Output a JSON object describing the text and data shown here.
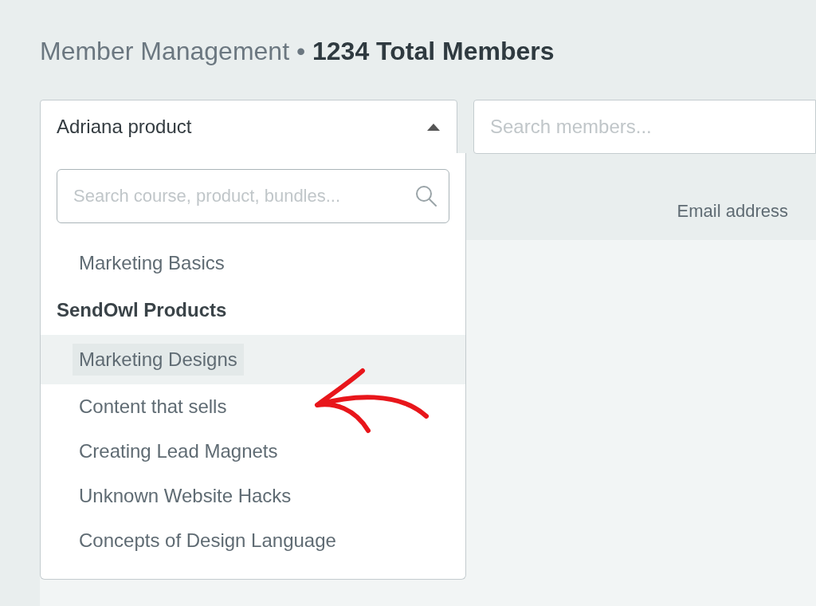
{
  "header": {
    "title": "Member Management",
    "separator": "•",
    "count": "1234 Total Members"
  },
  "product_select": {
    "value": "Adriana product",
    "expanded": true,
    "search_placeholder": "Search course, product, bundles...",
    "items": [
      {
        "kind": "item",
        "label": "Marketing Basics",
        "selected": false
      },
      {
        "kind": "group",
        "label": "SendOwl Products"
      },
      {
        "kind": "item",
        "label": "Marketing Designs",
        "selected": true
      },
      {
        "kind": "item",
        "label": "Content that sells",
        "selected": false
      },
      {
        "kind": "item",
        "label": "Creating Lead Magnets",
        "selected": false
      },
      {
        "kind": "item",
        "label": "Unknown Website Hacks",
        "selected": false
      },
      {
        "kind": "item",
        "label": "Concepts of Design Language",
        "selected": false
      }
    ]
  },
  "member_search": {
    "placeholder": "Search members..."
  },
  "table": {
    "columns": [
      "Email address"
    ]
  }
}
